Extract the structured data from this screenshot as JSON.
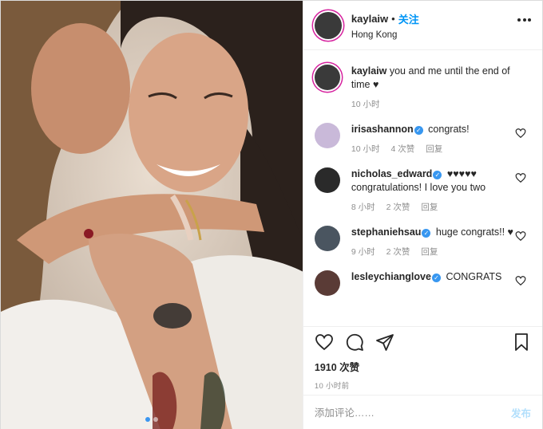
{
  "post": {
    "username": "kaylaiw",
    "separator": "•",
    "follow_label": "关注",
    "location": "Hong Kong",
    "more_icon": "more-horizontal-icon"
  },
  "caption": {
    "username": "kaylaiw",
    "text": "you and me until the end of time ♥",
    "time": "10 小时"
  },
  "comments": [
    {
      "username": "irisashannon",
      "verified": true,
      "text": "congrats!",
      "time": "10 小时",
      "likes": "4 次赞",
      "reply": "回复",
      "avatar_color": "#c9b9d9"
    },
    {
      "username": "nicholas_edward",
      "verified": true,
      "text": "♥♥♥♥♥ congratulations! I love you two",
      "time": "8 小时",
      "likes": "2 次赞",
      "reply": "回复",
      "avatar_color": "#2a2a2a"
    },
    {
      "username": "stephaniehsau",
      "verified": true,
      "text": "huge congrats!! ♥",
      "time": "9 小时",
      "likes": "2 次赞",
      "reply": "回复",
      "avatar_color": "#4a5560"
    },
    {
      "username": "lesleychianglove",
      "verified": true,
      "text": "CONGRATS",
      "avatar_color": "#5a3b36"
    }
  ],
  "actions": {
    "like_icon": "heart-icon",
    "comment_icon": "comment-icon",
    "share_icon": "send-icon",
    "save_icon": "bookmark-icon",
    "likes_count": "1910 次赞",
    "timestamp": "10 小时前"
  },
  "add_comment": {
    "placeholder": "添加评论……",
    "post_label": "发布"
  },
  "colors": {
    "accent_blue": "#0095f6",
    "verified_blue": "#3897f0",
    "muted_text": "#8e8e8e",
    "border": "#efefef"
  }
}
